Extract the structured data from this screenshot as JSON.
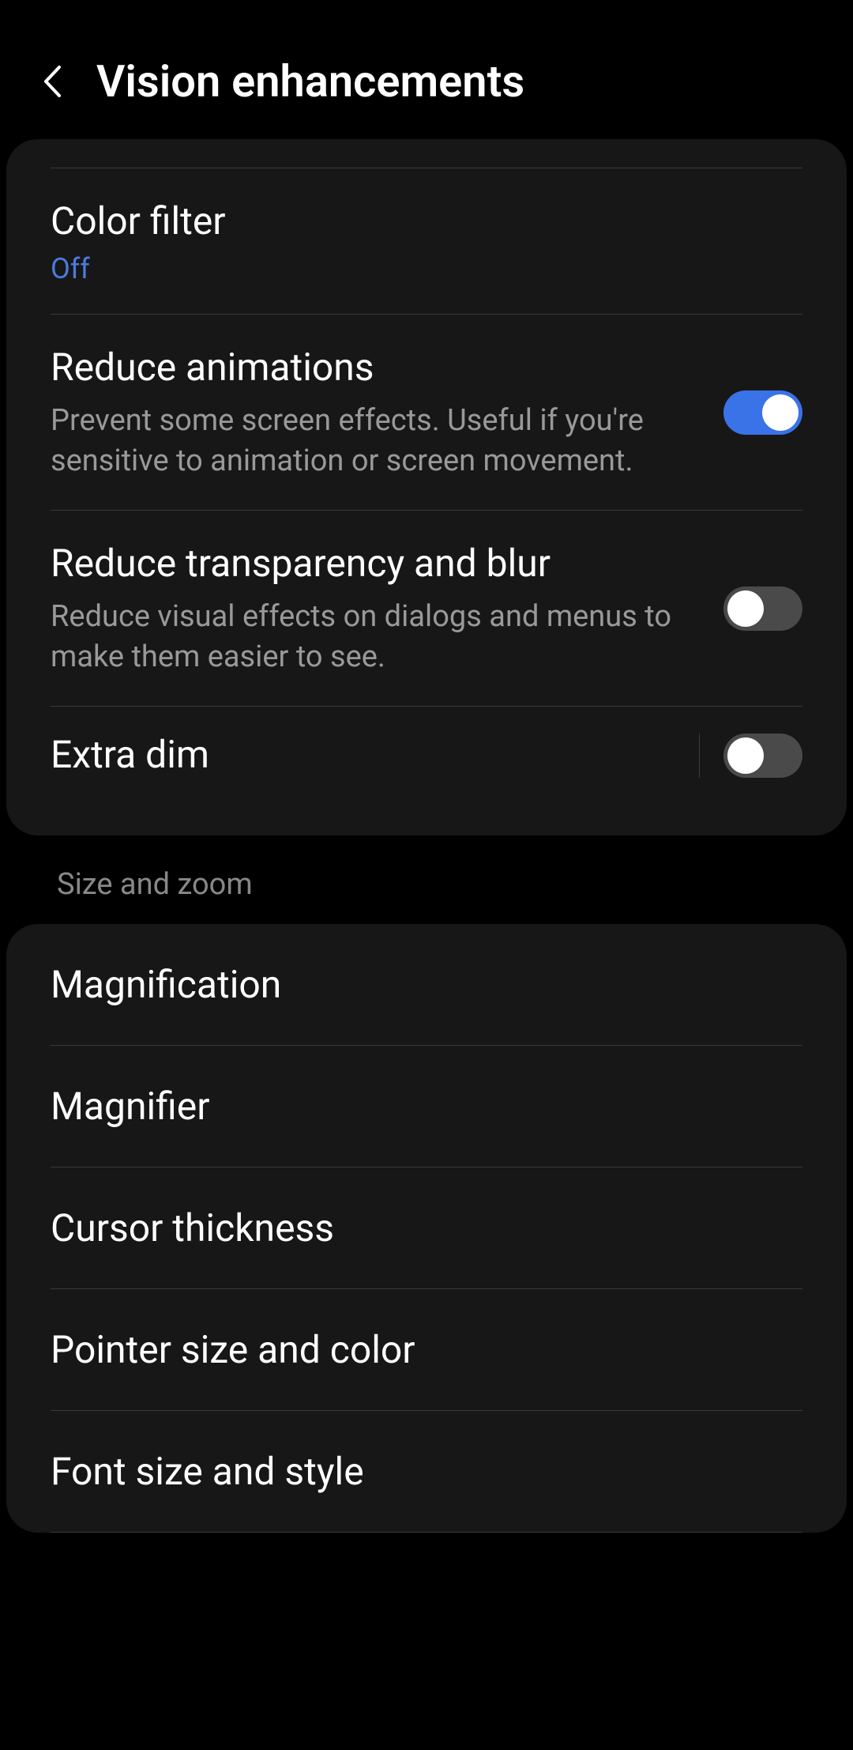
{
  "header": {
    "title": "Vision enhancements"
  },
  "items": {
    "color_filter": {
      "title": "Color filter",
      "status": "Off"
    },
    "reduce_animations": {
      "title": "Reduce animations",
      "description": "Prevent some screen effects. Useful if you're sensitive to animation or screen movement.",
      "enabled": true
    },
    "reduce_transparency": {
      "title": "Reduce transparency and blur",
      "description": "Reduce visual effects on dialogs and menus to make them easier to see.",
      "enabled": false
    },
    "extra_dim": {
      "title": "Extra dim",
      "enabled": false
    }
  },
  "section_header": "Size and zoom",
  "size_zoom": {
    "magnification": "Magnification",
    "magnifier": "Magnifier",
    "cursor_thickness": "Cursor thickness",
    "pointer_size": "Pointer size and color",
    "font_size": "Font size and style"
  }
}
